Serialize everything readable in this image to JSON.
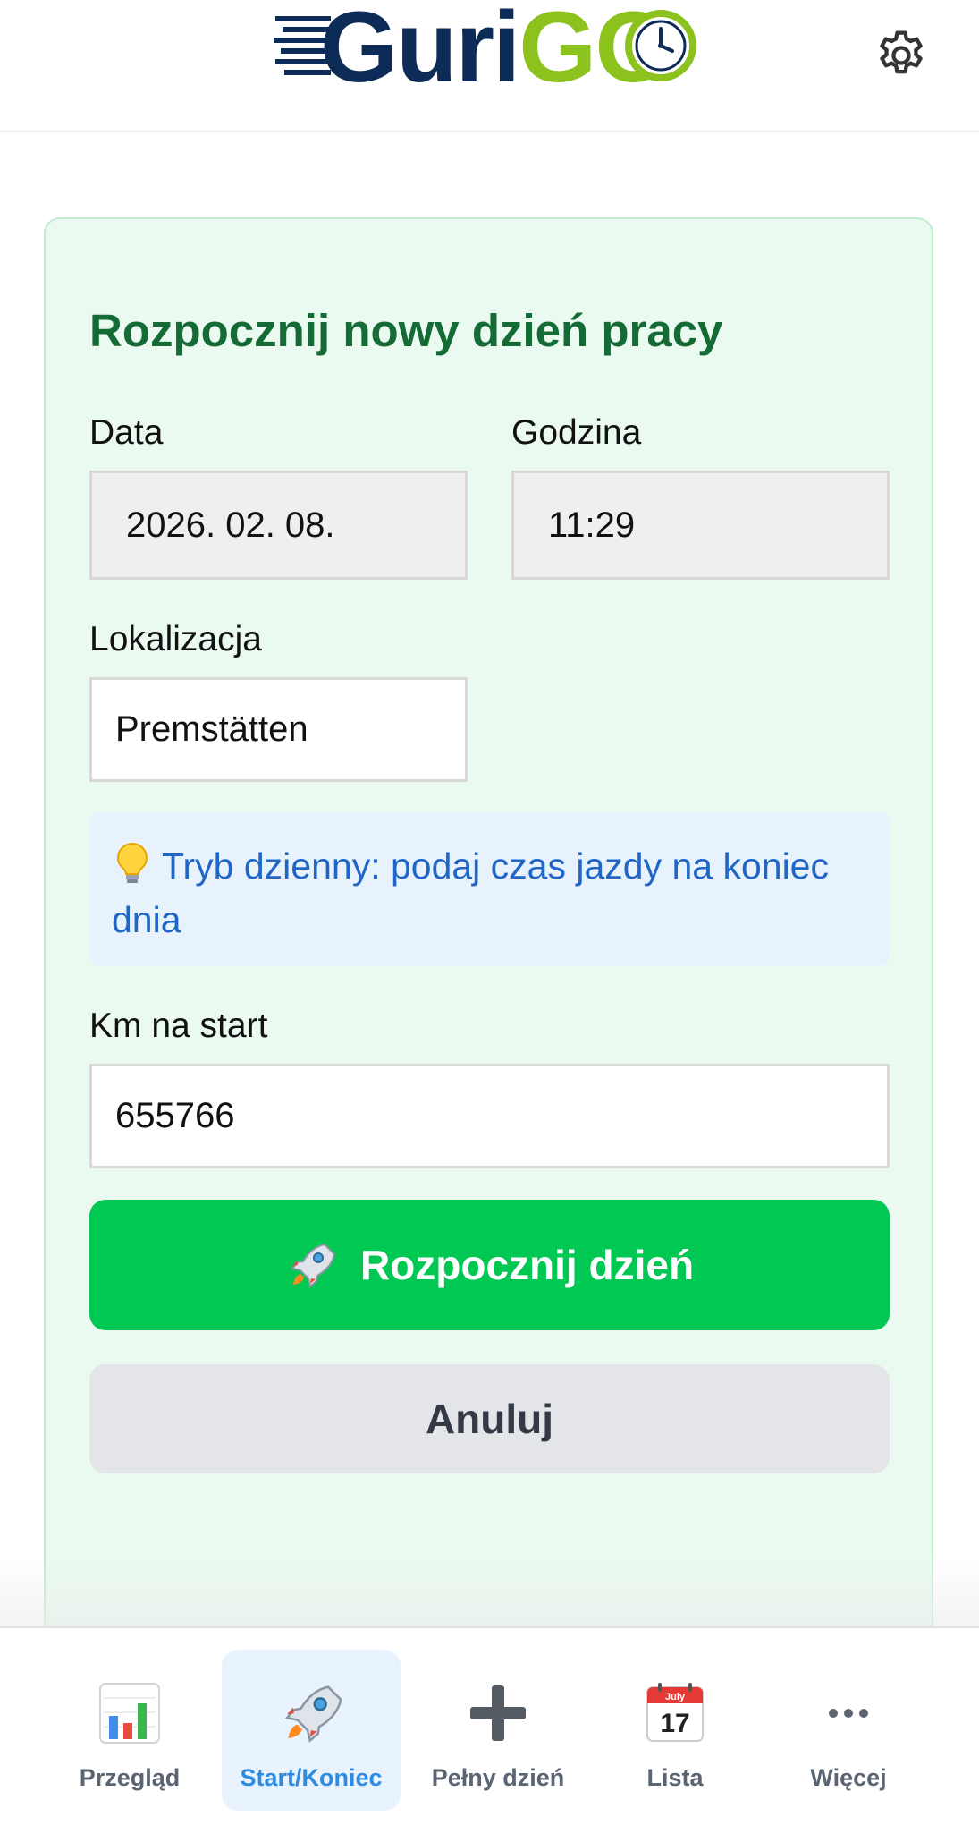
{
  "app": {
    "logo_text_part1": "Guri",
    "logo_text_part2": "GO",
    "settings_icon": "gear-icon"
  },
  "form": {
    "title": "Rozpocznij nowy dzień pracy",
    "date_label": "Data",
    "date_value": "2026. 02. 08.",
    "time_label": "Godzina",
    "time_value": "11:29",
    "location_label": "Lokalizacja",
    "location_value": "Premstätten",
    "info_icon": "lightbulb-icon",
    "info_text": "Tryb dzienny: podaj czas jazdy na koniec dnia",
    "km_label": "Km na start",
    "km_value": "655766",
    "start_button_icon": "rocket-icon",
    "start_button_label": "Rozpocznij dzień",
    "cancel_button_label": "Anuluj"
  },
  "bottom_nav": {
    "active": "Start/Koniec",
    "items": [
      {
        "label": "Przegląd",
        "icon": "bar-chart-icon"
      },
      {
        "label": "Start/Koniec",
        "icon": "rocket-icon"
      },
      {
        "label": "Pełny dzień",
        "icon": "plus-icon"
      },
      {
        "label": "Lista",
        "icon": "calendar-icon",
        "icon_text_month": "July",
        "icon_text_day": "17"
      },
      {
        "label": "Więcej",
        "icon": "more-dots-icon"
      }
    ]
  },
  "colors": {
    "brand_navy": "#0d2b57",
    "brand_green": "#8cc21d",
    "card_bg": "#eafaf0",
    "title_green": "#156b35",
    "primary_button": "#00c853",
    "info_text": "#1f66c6",
    "active_nav": "#2f8be0"
  }
}
